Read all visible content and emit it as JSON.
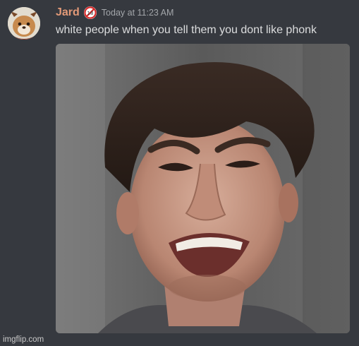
{
  "message": {
    "username": "Jard",
    "timestamp": "Today at 11:23 AM",
    "text": "white people when you tell them you dont like phonk",
    "role_badge_icon": "no-symbol-icon",
    "avatar_icon": "cartoon-dog-avatar-icon",
    "username_color": "#e39a78"
  },
  "attachment": {
    "subject": "crying-man-photo"
  },
  "watermark": "imgflip.com"
}
